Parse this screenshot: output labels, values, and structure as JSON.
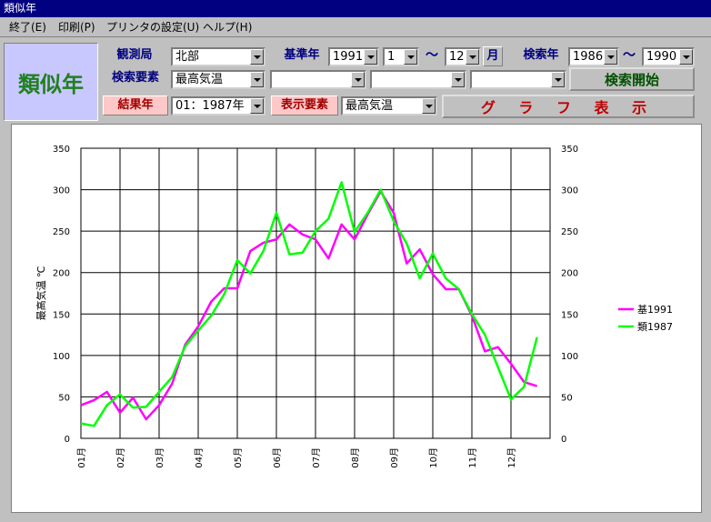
{
  "window": {
    "title": "類似年"
  },
  "menu": [
    "終了(E)",
    "印刷(P)",
    "プリンタの設定(U)",
    "ヘルプ(H)"
  ],
  "app_label": "類似年",
  "form": {
    "station_label": "観測局",
    "station_value": "北部",
    "base_year_label": "基準年",
    "base_year_value": "1991",
    "month_from": "1",
    "range_sep": "〜",
    "month_to": "12",
    "month_suffix": "月",
    "search_year_label": "検索年",
    "search_year_from": "1986",
    "search_year_sep": "〜",
    "search_year_to": "1990",
    "search_element_label": "検索要素",
    "search_element_value": "最高気温",
    "search_element_2": "",
    "search_element_3": "",
    "search_element_4": "",
    "search_button": "検索開始",
    "result_year_label": "結果年",
    "result_year_value": "01：1987年",
    "display_element_label": "表示要素",
    "display_element_value": "最高気温",
    "graph_button": "グ ラ フ 表 示"
  },
  "colors": {
    "series_base": "#ff00ff",
    "series_similar": "#00ff00"
  },
  "chart_data": {
    "type": "line",
    "ylabel": "最高気温 ℃",
    "ylim": [
      0,
      350
    ],
    "yticks": [
      0,
      50,
      100,
      150,
      200,
      250,
      300,
      350
    ],
    "xlim": [
      0,
      36
    ],
    "x_tick_labels": [
      "01月",
      "02月",
      "03月",
      "04月",
      "05月",
      "06月",
      "07月",
      "08月",
      "09月",
      "10月",
      "11月",
      "12月"
    ],
    "grid": true,
    "legend_position": "right",
    "series": [
      {
        "name": "基1991",
        "color": "#ff00ff",
        "values": [
          40,
          46,
          56,
          31,
          49,
          23,
          40,
          66,
          113,
          135,
          165,
          181,
          181,
          226,
          236,
          240,
          258,
          246,
          240,
          217,
          258,
          240,
          270,
          298,
          272,
          211,
          228,
          198,
          180,
          180,
          148,
          105,
          110,
          90,
          68,
          63
        ]
      },
      {
        "name": "類1987",
        "color": "#00ff00",
        "values": [
          18,
          15,
          40,
          53,
          37,
          38,
          56,
          74,
          111,
          130,
          148,
          174,
          215,
          199,
          226,
          272,
          222,
          224,
          250,
          265,
          309,
          249,
          272,
          300,
          262,
          235,
          193,
          223,
          193,
          180,
          150,
          125,
          86,
          47,
          62,
          122
        ]
      }
    ]
  }
}
